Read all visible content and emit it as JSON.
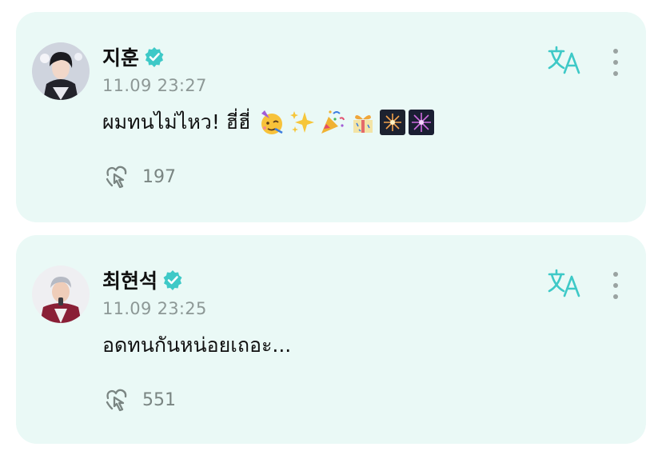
{
  "accent_color": "#3ec9c7",
  "card_background": "#eaf9f6",
  "posts": [
    {
      "author": "지훈",
      "verified": true,
      "timestamp": "11.09 23:27",
      "message": "ผมทนไม่ไหว! ฮี่ฮี่",
      "emojis": [
        "partying-face",
        "sparkles",
        "party-popper",
        "wrapped-gift",
        "fireworks",
        "sparkler"
      ],
      "likes": "197",
      "avatar_icon": "avatar-photo"
    },
    {
      "author": "최현석",
      "verified": true,
      "timestamp": "11.09 23:25",
      "message": "อดทนกันหน่อยเถอะ...",
      "emojis": [],
      "likes": "551",
      "avatar_icon": "avatar-photo"
    }
  ],
  "icons": {
    "translate": "translate-icon",
    "more": "more-vertical-icon",
    "like": "heart-tap-icon",
    "verified": "verified-badge-icon"
  }
}
